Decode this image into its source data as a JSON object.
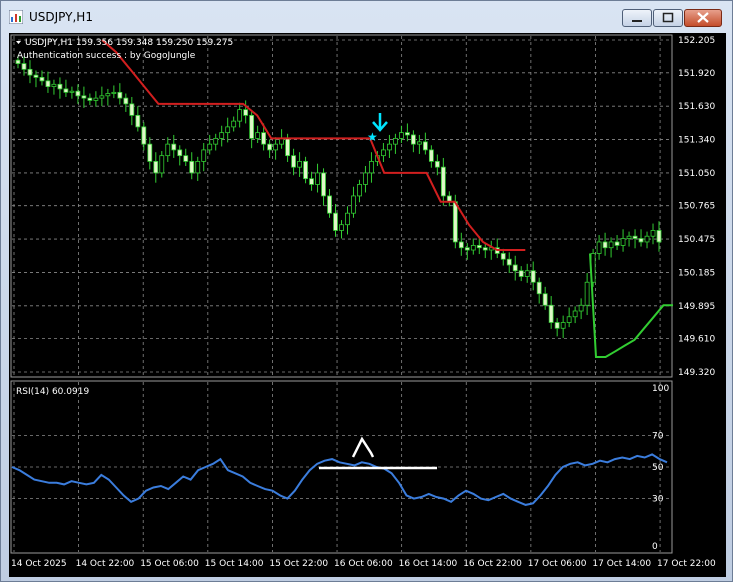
{
  "window": {
    "title": "USDJPY,H1",
    "controls": [
      "minimize-button",
      "maximize-button",
      "close-button"
    ]
  },
  "price_panel": {
    "header": "USDJPY,H1  159.356 159.348 159.250 159.275",
    "message": "Authentication success : by GogoJungle",
    "price_ticks": [
      "152.205",
      "151.920",
      "151.630",
      "151.340",
      "151.050",
      "150.765",
      "150.475",
      "150.185",
      "149.895",
      "149.610",
      "149.320"
    ],
    "colors": {
      "bg": "#000000",
      "candle": "#32cd32",
      "grid": "#808080",
      "trail_red": "#d21f1f",
      "trail_green": "#32cd32",
      "signal": "#00ffff"
    }
  },
  "rsi_panel": {
    "label": "RSI(14) 60.0919",
    "levels": [
      "100",
      "70",
      "50",
      "30",
      "0"
    ],
    "line_color": "#3b7ddd"
  },
  "time_axis": [
    "14 Oct 2025",
    "14 Oct 22:00",
    "15 Oct 06:00",
    "15 Oct 14:00",
    "15 Oct 22:00",
    "16 Oct 06:00",
    "16 Oct 14:00",
    "16 Oct 22:00",
    "17 Oct 06:00",
    "17 Oct 14:00",
    "17 Oct 22:00"
  ],
  "chart_data": [
    {
      "type": "candlestick",
      "title": "USDJPY,H1",
      "ylim": [
        149.32,
        152.205
      ],
      "y_ticks": [
        152.205,
        151.92,
        151.63,
        151.34,
        151.05,
        150.765,
        150.475,
        150.185,
        149.895,
        149.61,
        149.32
      ],
      "x_ticks": [
        "14 Oct 2025",
        "14 Oct 22:00",
        "15 Oct 06:00",
        "15 Oct 14:00",
        "15 Oct 22:00",
        "16 Oct 06:00",
        "16 Oct 14:00",
        "16 Oct 22:00",
        "17 Oct 06:00",
        "17 Oct 14:00",
        "17 Oct 22:00"
      ],
      "close": [
        152.0,
        151.95,
        151.9,
        151.88,
        151.85,
        151.8,
        151.82,
        151.78,
        151.75,
        151.76,
        151.72,
        151.7,
        151.68,
        151.7,
        151.72,
        151.74,
        151.75,
        151.7,
        151.65,
        151.55,
        151.45,
        151.3,
        151.15,
        151.05,
        151.2,
        151.3,
        151.25,
        151.2,
        151.15,
        151.05,
        151.15,
        151.25,
        151.3,
        151.35,
        151.4,
        151.45,
        151.5,
        151.6,
        151.55,
        151.35,
        151.4,
        151.3,
        151.25,
        151.3,
        151.35,
        151.2,
        151.1,
        151.15,
        151.0,
        150.95,
        151.05,
        150.85,
        150.7,
        150.55,
        150.6,
        150.7,
        150.85,
        150.95,
        151.05,
        151.15,
        151.2,
        151.25,
        151.3,
        151.35,
        151.4,
        151.38,
        151.3,
        151.32,
        151.25,
        151.15,
        151.1,
        150.85,
        150.8,
        150.45,
        150.4,
        150.38,
        150.42,
        150.4,
        150.38,
        150.4,
        150.35,
        150.3,
        150.25,
        150.2,
        150.15,
        150.2,
        150.1,
        150.0,
        149.9,
        149.75,
        149.7,
        149.75,
        149.8,
        149.85,
        149.9,
        150.1,
        150.35,
        150.45,
        150.4,
        150.45,
        150.42,
        150.48,
        150.5,
        150.48,
        150.45,
        150.5,
        150.55,
        150.45
      ],
      "trailing_stop_red": [
        152.205,
        152.1,
        151.95,
        151.8,
        151.65,
        151.65,
        151.65,
        151.65,
        151.65,
        151.65,
        151.65,
        151.55,
        151.35,
        151.35,
        151.35,
        151.35,
        151.35,
        151.35,
        151.35,
        151.35,
        151.05,
        151.05,
        151.05,
        151.05,
        150.8,
        150.8,
        150.6,
        150.45,
        150.38,
        150.38,
        150.38
      ],
      "trailing_stop_green": [
        149.45,
        149.45,
        149.5,
        149.55,
        149.6,
        149.7,
        149.8,
        149.9,
        149.9
      ],
      "signal": "sell arrow near 16 Oct 06:00",
      "series": [
        {
          "name": "RSI(14) 60.0919",
          "values": [
            50,
            48,
            45,
            42,
            41,
            40,
            40,
            39,
            41,
            40,
            39,
            40,
            45,
            42,
            37,
            32,
            28,
            30,
            35,
            37,
            38,
            36,
            40,
            44,
            42,
            48,
            50,
            52,
            55,
            48,
            46,
            44,
            40,
            38,
            36,
            35,
            32,
            30,
            35,
            42,
            48,
            52,
            54,
            55,
            53,
            52,
            51,
            53,
            52,
            50,
            49,
            46,
            40,
            32,
            30,
            31,
            33,
            31,
            30,
            28,
            32,
            35,
            33,
            30,
            29,
            31,
            33,
            30,
            28,
            26,
            27,
            32,
            38,
            45,
            50,
            52,
            53,
            51,
            52,
            54,
            53,
            55,
            56,
            55,
            57,
            56,
            58,
            55,
            53
          ]
        }
      ]
    }
  ]
}
